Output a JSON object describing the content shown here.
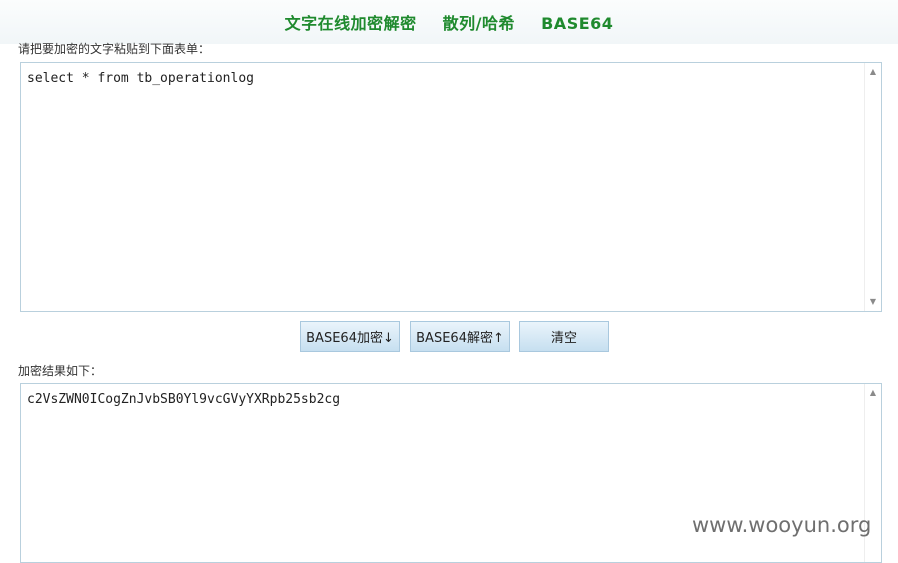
{
  "header": {
    "title_parts": [
      "文字在线加密解密",
      "散列/哈希",
      "BASE64"
    ]
  },
  "input_section": {
    "label": "请把要加密的文字粘贴到下面表单：",
    "value": "select * from tb_operationlog"
  },
  "buttons": {
    "encode": "BASE64加密↓",
    "decode": "BASE64解密↑",
    "clear": "清空"
  },
  "output_section": {
    "label": "加密结果如下：",
    "value": "c2VsZWN0ICogZnJvbSB0Yl9vcGVyYXRpb25sb2cg"
  },
  "watermark": "www.wooyun.org",
  "icons": [
    "scroll-up-arrow-icon",
    "scroll-down-arrow-icon"
  ],
  "colors": {
    "title_green": "#1f8a2e",
    "button_gradient_top": "#eaf4fb",
    "button_gradient_bottom": "#c6dff0",
    "border": "#b9d0dd"
  }
}
